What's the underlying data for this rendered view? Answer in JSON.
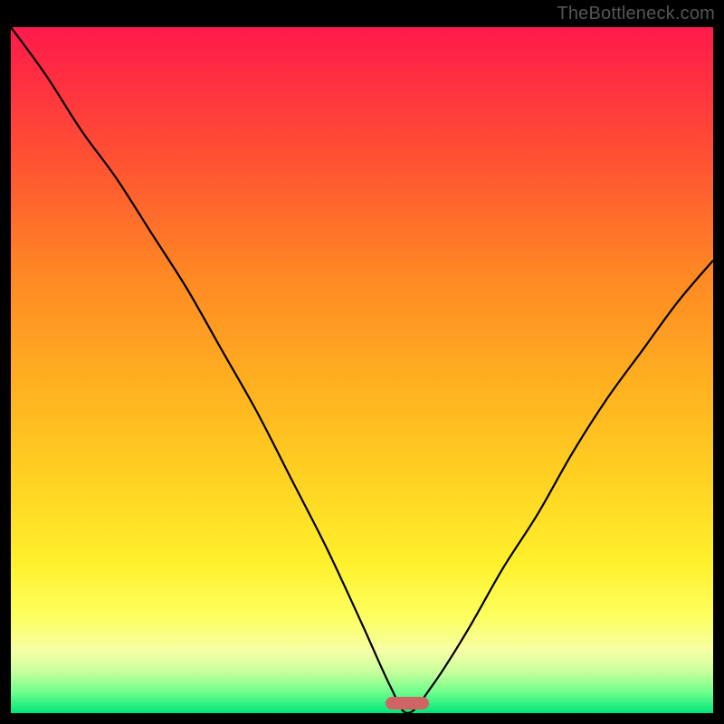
{
  "watermark": "TheBottleneck.com",
  "marker": {
    "x_frac": 0.565,
    "y_frac": 0.985
  },
  "chart_data": {
    "type": "line",
    "title": "",
    "xlabel": "",
    "ylabel": "",
    "xlim": [
      0,
      1
    ],
    "ylim": [
      0,
      1
    ],
    "series": [
      {
        "name": "curve",
        "x": [
          0.0,
          0.05,
          0.1,
          0.15,
          0.2,
          0.25,
          0.3,
          0.35,
          0.4,
          0.45,
          0.5,
          0.54,
          0.565,
          0.6,
          0.65,
          0.7,
          0.75,
          0.8,
          0.85,
          0.9,
          0.95,
          1.0
        ],
        "y": [
          1.0,
          0.93,
          0.85,
          0.78,
          0.7,
          0.62,
          0.53,
          0.44,
          0.34,
          0.24,
          0.13,
          0.04,
          0.0,
          0.04,
          0.12,
          0.21,
          0.29,
          0.38,
          0.46,
          0.53,
          0.6,
          0.66
        ]
      }
    ],
    "background_gradient": {
      "top": "#ff1a4b",
      "mid": "#ffe039",
      "bottom": "#00e57a"
    }
  }
}
